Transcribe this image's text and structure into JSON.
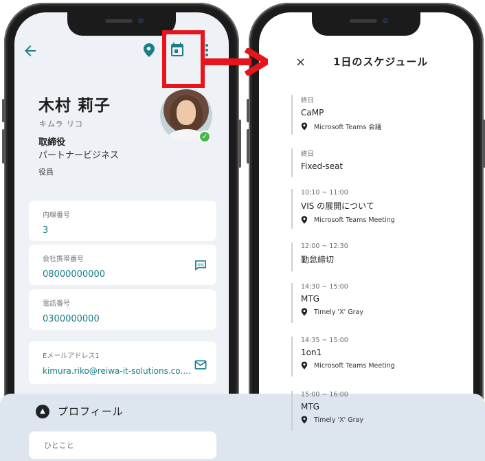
{
  "contact": {
    "name": "木村 莉子",
    "kana": "キムラ リコ",
    "title": "取締役",
    "department": "パートナービジネス",
    "role": "役員",
    "status_color": "#45b649",
    "fields": [
      {
        "label": "内線番号",
        "value": "3"
      },
      {
        "label": "会社携帯番号",
        "value": "08000000000"
      },
      {
        "label": "電話番号",
        "value": "0300000000"
      },
      {
        "label": "Eメールアドレス1",
        "value": "kimura.riko@reiwa-it-solutions.co...."
      }
    ],
    "profile_section": "プロフィール",
    "oneword_label": "ひとこと"
  },
  "icons": {
    "back": "arrow-left-icon",
    "location": "location-pin-icon",
    "calendar": "calendar-icon",
    "sms": "sms-icon",
    "mail": "mail-icon",
    "close": "close-icon",
    "expand": "chevron-up-icon"
  },
  "colors": {
    "accent": "#147c86",
    "highlight": "#e8141c",
    "arrow": "#e8141c"
  },
  "schedule": {
    "close_label": "×",
    "title": "1日のスケジュール",
    "events": [
      {
        "time": "終日",
        "title": "CaMP",
        "location": "Microsoft Teams 会議"
      },
      {
        "time": "終日",
        "title": "Fixed-seat",
        "location": ""
      },
      {
        "time": "10:10 ~ 11:00",
        "title": "VIS の展開について",
        "location": "Microsoft Teams Meeting"
      },
      {
        "time": "12:00 ~ 12:30",
        "title": "勤怠締切",
        "location": ""
      },
      {
        "time": "14:30 ~ 15:00",
        "title": "MTG",
        "location": "Timely 'X' Gray"
      },
      {
        "time": "14:35 ~ 15:00",
        "title": "1on1",
        "location": "Microsoft Teams Meeting"
      },
      {
        "time": "15:00 ~ 16:00",
        "title": "MTG",
        "location": "Timely 'X' Gray"
      }
    ]
  }
}
